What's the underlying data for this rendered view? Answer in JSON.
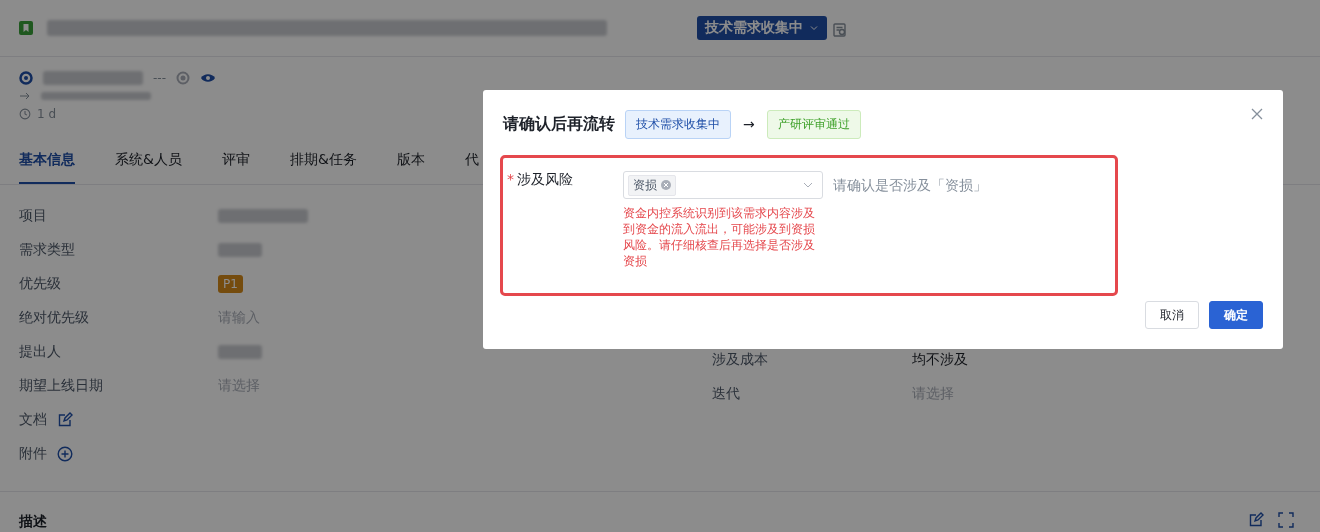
{
  "header": {
    "status_button": "技术需求收集中"
  },
  "meta": {
    "separator": "---",
    "duration": "1 d"
  },
  "tabs": [
    {
      "label": "基本信息",
      "selected": true
    },
    {
      "label": "系统&人员",
      "selected": false
    },
    {
      "label": "评审",
      "selected": false
    },
    {
      "label": "排期&任务",
      "selected": false
    },
    {
      "label": "版本",
      "selected": false
    },
    {
      "label": "代",
      "selected": false
    }
  ],
  "fields_left": [
    {
      "label": "项目",
      "kind": "redacted"
    },
    {
      "label": "需求类型",
      "kind": "redacted"
    },
    {
      "label": "优先级",
      "kind": "badge",
      "value": "P1"
    },
    {
      "label": "绝对优先级",
      "kind": "placeholder",
      "placeholder": "请输入"
    },
    {
      "label": "提出人",
      "kind": "redacted"
    },
    {
      "label": "期望上线日期",
      "kind": "placeholder",
      "placeholder": "请选择"
    },
    {
      "label": "文档",
      "kind": "edit"
    },
    {
      "label": "附件",
      "kind": "add"
    }
  ],
  "fields_right": [
    {
      "label": "涉及成本",
      "kind": "text",
      "value": "均不涉及"
    },
    {
      "label": "迭代",
      "kind": "placeholder",
      "placeholder": "请选择"
    }
  ],
  "section": {
    "title": "描述"
  },
  "dialog": {
    "title": "请确认后再流转",
    "from_status": "技术需求收集中",
    "arrow": "→",
    "to_status": "产研评审通过",
    "field": {
      "label": "涉及风险",
      "required_mark": "*",
      "tags": [
        "资损"
      ],
      "hint": "请确认是否涉及「资损」",
      "error": "资金内控系统识别到该需求内容涉及到资金的流入流出，可能涉及到资损风险。请仔细核查后再选择是否涉及资损"
    },
    "buttons": [
      {
        "label": "取消",
        "kind": "default"
      },
      {
        "label": "确定",
        "kind": "primary"
      }
    ]
  }
}
